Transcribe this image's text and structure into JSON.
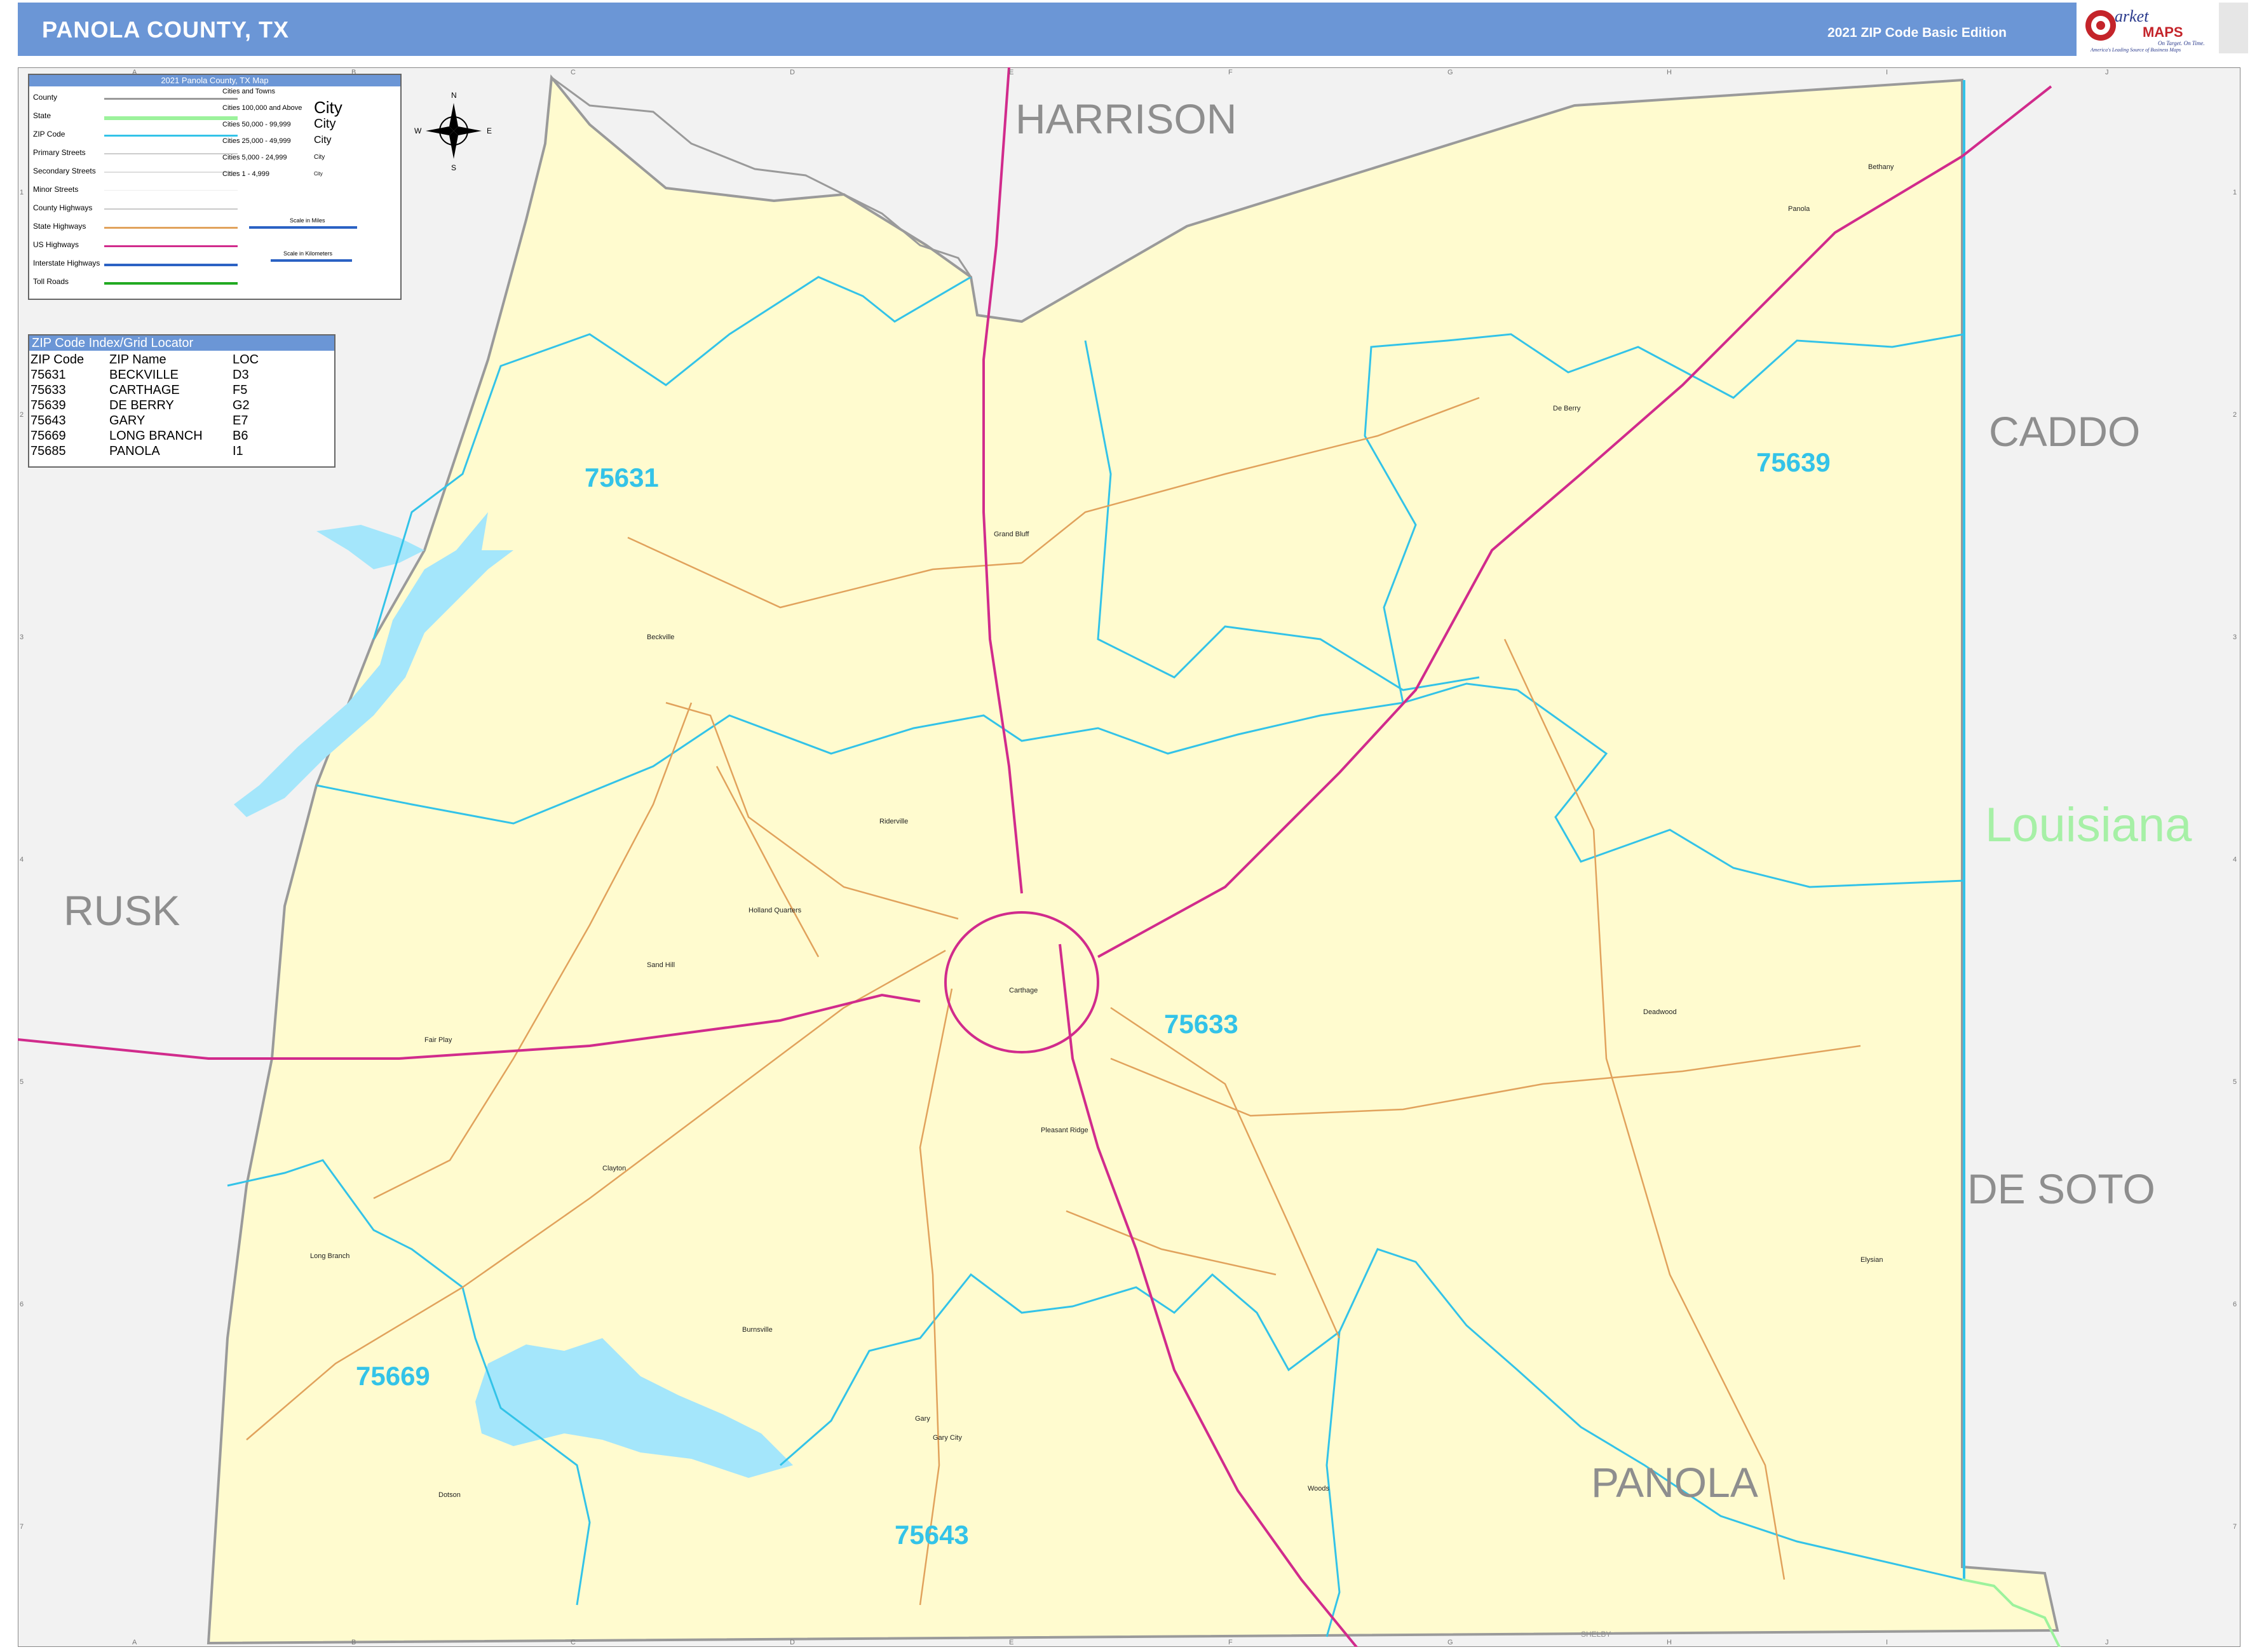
{
  "header": {
    "title": "PANOLA COUNTY, TX",
    "edition": "2021 ZIP Code Basic Edition",
    "colors": {
      "bar": "#6b96d6",
      "text": "#ffffff"
    }
  },
  "logo": {
    "brand_top": "arket",
    "brand_bottom": "MAPS",
    "tagline_1": "On Target. On Time.",
    "tagline_2": "America's Leading Source of Business Maps"
  },
  "legend": {
    "title": "2021 Panola County, TX Map",
    "rows": [
      {
        "label": "County",
        "color": "#9a9a9a"
      },
      {
        "label": "State",
        "color": "#9cf29c"
      },
      {
        "label": "ZIP Code",
        "color": "#33c3e8"
      },
      {
        "label": "Primary Streets",
        "color": "#cccccc"
      },
      {
        "label": "Secondary Streets",
        "color": "#dddddd"
      },
      {
        "label": "Minor Streets",
        "color": "#eeeeee"
      },
      {
        "label": "County Highways",
        "color": "#c9c9c9"
      },
      {
        "label": "State Highways",
        "color": "#e1a25c"
      },
      {
        "label": "US Highways",
        "color": "#d12b8c"
      },
      {
        "label": "Interstate Highways",
        "color": "#2b62c4"
      },
      {
        "label": "Toll Roads",
        "color": "#22aa22"
      }
    ],
    "cities_heading": "Cities and Towns",
    "city_classes": [
      {
        "label": "Cities 100,000 and Above",
        "sample": "City"
      },
      {
        "label": "Cities 50,000 - 99,999",
        "sample": "City"
      },
      {
        "label": "Cities 25,000 - 49,999",
        "sample": "City"
      },
      {
        "label": "Cities 5,000 - 24,999",
        "sample": "City"
      },
      {
        "label": "Cities 1 - 4,999",
        "sample": "City"
      }
    ],
    "scale_miles": "Scale in Miles",
    "scale_km": "Scale in Kilometers"
  },
  "zip_index": {
    "title": "ZIP Code Index/Grid Locator",
    "columns": [
      "ZIP Code",
      "ZIP Name",
      "LOC"
    ],
    "rows": [
      [
        "75631",
        "BECKVILLE",
        "D3"
      ],
      [
        "75633",
        "CARTHAGE",
        "F5"
      ],
      [
        "75639",
        "DE BERRY",
        "G2"
      ],
      [
        "75643",
        "GARY",
        "E7"
      ],
      [
        "75669",
        "LONG BRANCH",
        "B6"
      ],
      [
        "75685",
        "PANOLA",
        "I1"
      ]
    ]
  },
  "grid": {
    "columns": [
      "A",
      "B",
      "C",
      "D",
      "E",
      "F",
      "G",
      "H",
      "I",
      "J"
    ],
    "rows": [
      "1",
      "2",
      "3",
      "4",
      "5",
      "6",
      "7"
    ]
  },
  "regions": {
    "harrison": "HARRISON",
    "caddo": "CADDO",
    "louisiana": "Louisiana",
    "rusk": "RUSK",
    "de_soto": "DE SOTO",
    "panola": "PANOLA",
    "shelby": "SHELBY"
  },
  "zip_labels": {
    "z75631": "75631",
    "z75639": "75639",
    "z75633": "75633",
    "z75669": "75669",
    "z75643": "75643"
  },
  "towns": {
    "carthage": "Carthage",
    "beckville": "Beckville",
    "gary": "Gary",
    "gary_city": "Gary City",
    "long_branch": "Long Branch",
    "de_berry": "De Berry",
    "panola": "Panola",
    "bethany": "Bethany",
    "deadwood": "Deadwood",
    "clayton": "Clayton",
    "pleasant_ridge": "Pleasant Ridge",
    "fair_play": "Fair Play",
    "grand_bluff": "Grand Bluff",
    "holland_quarters": "Holland Quarters",
    "riderville": "Riderville",
    "dotson": "Dotson",
    "woods": "Woods",
    "elysian": "Elysian",
    "sand_hill": "Sand Hill",
    "burnsville": "Burnsville"
  },
  "colors": {
    "county_fill": "#fffbcf",
    "outside_fill": "#f2f2f2",
    "water": "#a4e6fb",
    "zip_line": "#33c3e8",
    "us_highway": "#d12b8c",
    "state_highway": "#e1a25c",
    "county_border": "#9a9a9a",
    "label_gray": "#8e8e8e",
    "louisiana_label": "#a6f0a6"
  }
}
